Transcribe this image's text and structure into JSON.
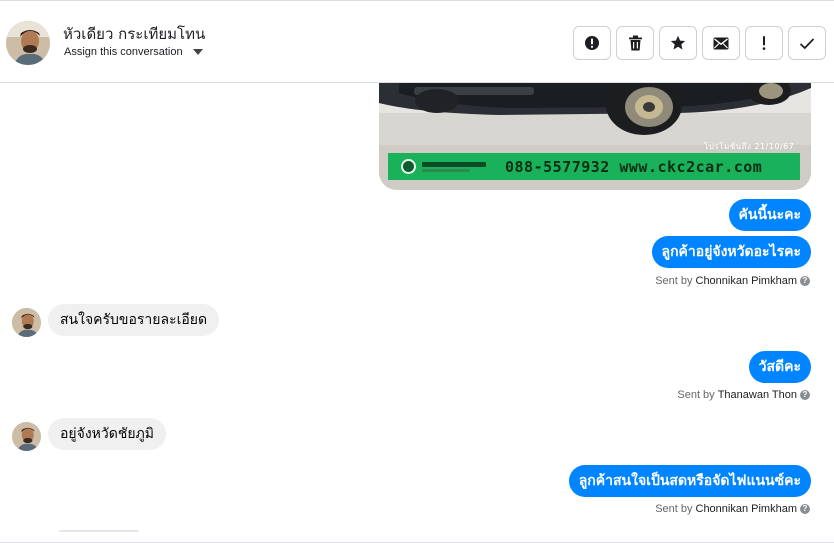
{
  "header": {
    "contact_name": "หัวเดียว กระเทียมโทน",
    "assign_label": "Assign this conversation",
    "actions": [
      {
        "id": "spam",
        "icon": "alert-circle-icon"
      },
      {
        "id": "delete",
        "icon": "trash-icon"
      },
      {
        "id": "star",
        "icon": "star-icon"
      },
      {
        "id": "unread",
        "icon": "envelope-icon"
      },
      {
        "id": "important",
        "icon": "exclamation-icon"
      },
      {
        "id": "done",
        "icon": "checkmark-icon"
      }
    ]
  },
  "image_attachment": {
    "banner_phone_site": "088-5577932 www.ckc2car.com",
    "date_stamp": "โปรโมชั่นถึง 21/10/67",
    "banner_color": "#19b25a"
  },
  "messages": [
    {
      "direction": "out",
      "text": "คันนี้นะคะ"
    },
    {
      "direction": "out",
      "text": "ลูกค้าอยู่จังหวัดอะไรคะ",
      "sent_by_prefix": "Sent by",
      "sent_by": "Chonnikan Pimkham"
    },
    {
      "direction": "in",
      "text": "สนใจครับขอรายละเอียด"
    },
    {
      "direction": "out",
      "text": "วัสดีคะ",
      "sent_by_prefix": "Sent by",
      "sent_by": "Thanawan Thon"
    },
    {
      "direction": "in",
      "text": "อยู่จังหวัดชัยภูมิ"
    },
    {
      "direction": "out",
      "text": "ลูกค้าสนใจเป็นสดหรือจัดไฟแนนซ์คะ",
      "sent_by_prefix": "Sent by",
      "sent_by": "Chonnikan Pimkham"
    }
  ],
  "help_glyph": "?",
  "colors": {
    "outgoing_bubble": "#0084ff",
    "incoming_bubble": "#f0f0f0"
  }
}
